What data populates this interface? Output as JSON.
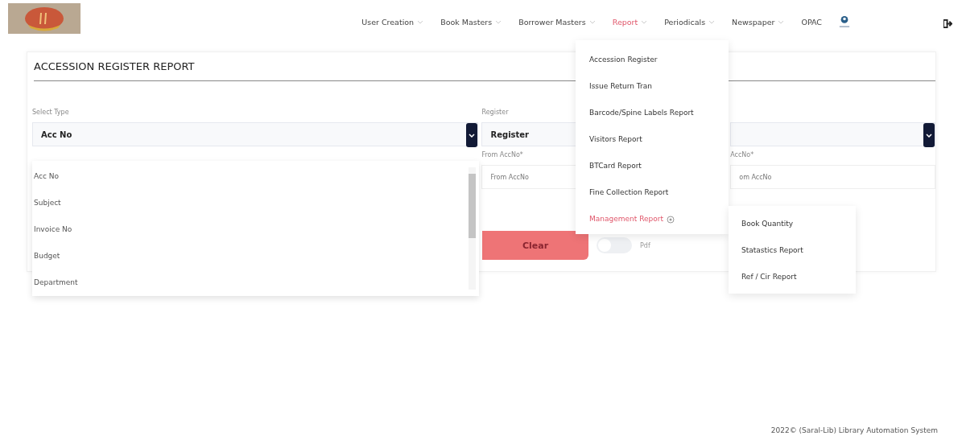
{
  "nav": {
    "items": [
      {
        "label": "User Creation",
        "dropdown": true,
        "selected": false
      },
      {
        "label": "Book Masters",
        "dropdown": true,
        "selected": false
      },
      {
        "label": "Borrower Masters",
        "dropdown": true,
        "selected": false
      },
      {
        "label": "Report",
        "dropdown": true,
        "selected": true
      },
      {
        "label": "Periodicals",
        "dropdown": true,
        "selected": false
      },
      {
        "label": "Newspaper",
        "dropdown": true,
        "selected": false
      },
      {
        "label": "OPAC",
        "dropdown": false,
        "selected": false
      }
    ]
  },
  "report_menu": {
    "items": [
      {
        "label": "Accession Register",
        "selected": false,
        "submenu": false
      },
      {
        "label": "Issue Return Tran",
        "selected": false,
        "submenu": false
      },
      {
        "label": "Barcode/Spine Labels Report",
        "selected": false,
        "submenu": false
      },
      {
        "label": "Visitors Report",
        "selected": false,
        "submenu": false
      },
      {
        "label": "BTCard Report",
        "selected": false,
        "submenu": false
      },
      {
        "label": "Fine Collection Report",
        "selected": false,
        "submenu": false
      },
      {
        "label": "Management Report",
        "selected": true,
        "submenu": true
      }
    ]
  },
  "submenu": {
    "items": [
      "Book Quantity",
      "Statastics Report",
      "Ref / Cir Report"
    ]
  },
  "page": {
    "title": "ACCESSION REGISTER REPORT"
  },
  "select_type": {
    "label": "Select Type",
    "value": "Acc No",
    "options": [
      "Acc No",
      "Subject",
      "Invoice No",
      "Budget",
      "Department"
    ]
  },
  "register": {
    "label": "Register",
    "value": "Register"
  },
  "from_accno": {
    "label": "From AccNo*",
    "placeholder": "From AccNo"
  },
  "to_accno": {
    "label": "AccNo*",
    "placeholder": "om AccNo"
  },
  "clear_button": "Clear",
  "pdf_toggle": {
    "label": "Pdf",
    "on": false
  },
  "footer": "2022© (Saral-Lib) Library Automation System"
}
